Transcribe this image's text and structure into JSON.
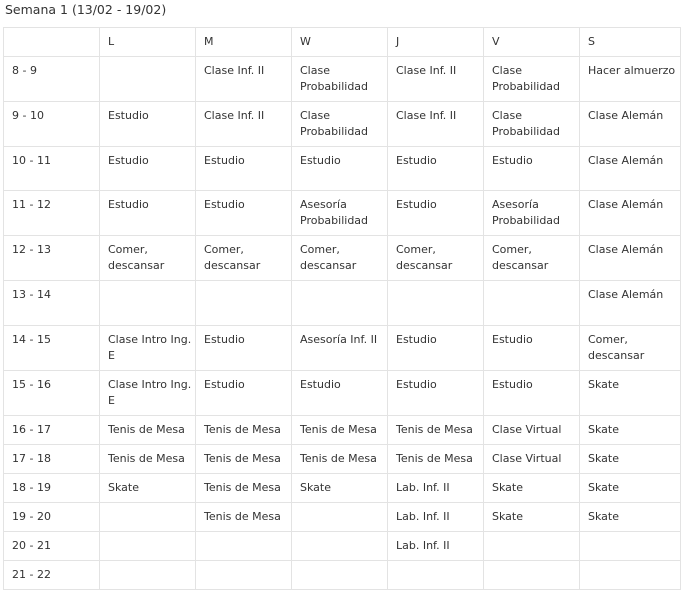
{
  "title": "Semana 1 (13/02 - 19/02)",
  "columns": [
    "",
    "L",
    "M",
    "W",
    "J",
    "V",
    "S"
  ],
  "rows": [
    {
      "time": "8 - 9",
      "cells": [
        "",
        "Clase Inf. II",
        "Clase Probabilidad",
        "Clase Inf. II",
        "Clase Probabilidad",
        "Hacer almuerzo"
      ]
    },
    {
      "time": "9 - 10",
      "cells": [
        "Estudio",
        "Clase Inf. II",
        "Clase Probabilidad",
        "Clase Inf. II",
        "Clase Probabilidad",
        "Clase Alemán"
      ]
    },
    {
      "time": "10 - 11",
      "cells": [
        "Estudio",
        "Estudio",
        "Estudio",
        "Estudio",
        "Estudio",
        "Clase Alemán"
      ]
    },
    {
      "time": "11 - 12",
      "cells": [
        "Estudio",
        "Estudio",
        "Asesoría Probabilidad",
        "Estudio",
        "Asesoría Probabilidad",
        "Clase Alemán"
      ]
    },
    {
      "time": "12 - 13",
      "cells": [
        "Comer, descansar",
        "Comer, descansar",
        "Comer, descansar",
        "Comer, descansar",
        "Comer, descansar",
        "Clase Alemán"
      ]
    },
    {
      "time": "13 - 14",
      "cells": [
        "",
        "",
        "",
        "",
        "",
        "Clase Alemán"
      ]
    },
    {
      "time": "14 - 15",
      "cells": [
        "Clase Intro Ing. E",
        "Estudio",
        "Asesoría Inf. II",
        "Estudio",
        "Estudio",
        "Comer, descansar"
      ]
    },
    {
      "time": "15 - 16",
      "cells": [
        "Clase Intro Ing. E",
        "Estudio",
        "Estudio",
        "Estudio",
        "Estudio",
        "Skate"
      ]
    },
    {
      "time": "16 - 17",
      "cells": [
        "Tenis de Mesa",
        "Tenis de Mesa",
        "Tenis de Mesa",
        "Tenis de Mesa",
        "Clase Virtual",
        "Skate"
      ]
    },
    {
      "time": "17 - 18",
      "cells": [
        "Tenis de Mesa",
        "Tenis de Mesa",
        "Tenis de Mesa",
        "Tenis de Mesa",
        "Clase Virtual",
        "Skate"
      ]
    },
    {
      "time": "18 - 19",
      "cells": [
        "Skate",
        "Tenis de Mesa",
        "Skate",
        "Lab. Inf. II",
        "Skate",
        "Skate"
      ]
    },
    {
      "time": "19 - 20",
      "cells": [
        "",
        "Tenis de Mesa",
        "",
        "Lab. Inf. II",
        "Skate",
        "Skate"
      ]
    },
    {
      "time": "20 - 21",
      "cells": [
        "",
        "",
        "",
        "Lab. Inf. II",
        "",
        ""
      ]
    },
    {
      "time": "21 - 22",
      "cells": [
        "",
        "",
        "",
        "",
        "",
        ""
      ]
    }
  ],
  "colors": {
    "text": "#333333",
    "border": "#e3e3e3",
    "background": "#ffffff"
  }
}
